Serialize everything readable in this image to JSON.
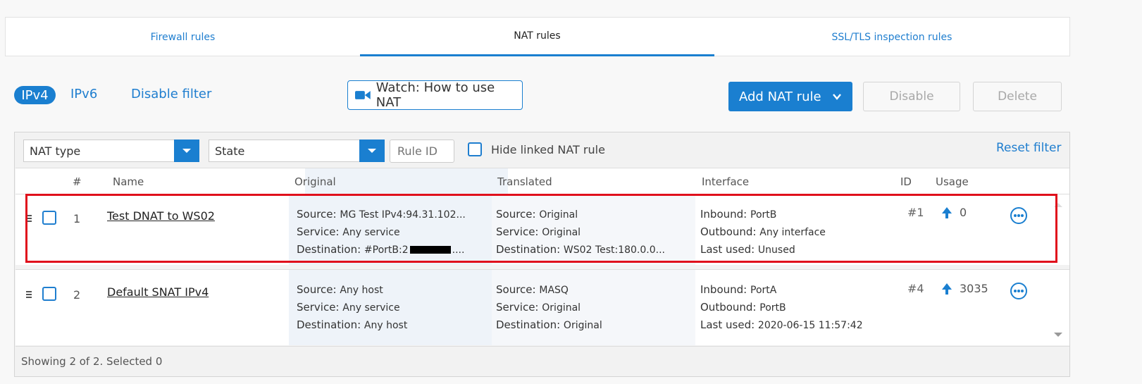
{
  "tabs": [
    {
      "label": "Firewall rules",
      "active": false
    },
    {
      "label": "NAT rules",
      "active": true
    },
    {
      "label": "SSL/TLS inspection rules",
      "active": false
    }
  ],
  "toolbar": {
    "ipv4": "IPv4",
    "ipv6": "IPv6",
    "disable_filter": "Disable filter",
    "watch_label": "Watch: How to use NAT",
    "add_rule": "Add NAT rule",
    "disable": "Disable",
    "delete": "Delete"
  },
  "filters": {
    "nat_type": "NAT type",
    "state": "State",
    "rule_id_placeholder": "Rule ID",
    "hide_linked": "Hide linked NAT rule",
    "reset": "Reset filter"
  },
  "columns": {
    "num": "#",
    "name": "Name",
    "original": "Original",
    "translated": "Translated",
    "interface": "Interface",
    "id": "ID",
    "usage": "Usage"
  },
  "rows": [
    {
      "num": "1",
      "name": "Test DNAT to WS02",
      "original": {
        "source_label": "Source:",
        "source": "MG Test IPv4:94.31.102...",
        "service_label": "Service:",
        "service": "Any service",
        "dest_label": "Destination:",
        "dest_prefix": "#PortB:2",
        "dest_suffix": "...."
      },
      "translated": {
        "source_label": "Source:",
        "source": "Original",
        "service_label": "Service:",
        "service": "Original",
        "dest_label": "Destination:",
        "dest": "WS02 Test:180.0.0..."
      },
      "interface": {
        "inbound_label": "Inbound:",
        "inbound": "PortB",
        "outbound_label": "Outbound:",
        "outbound": "Any interface",
        "last_label": "Last used:",
        "last": "Unused"
      },
      "id": "#1",
      "usage": "0"
    },
    {
      "num": "2",
      "name": "Default SNAT IPv4",
      "original": {
        "source_label": "Source:",
        "source": "Any host",
        "service_label": "Service:",
        "service": "Any service",
        "dest_label": "Destination:",
        "dest_prefix": "Any host",
        "dest_suffix": ""
      },
      "translated": {
        "source_label": "Source:",
        "source": "MASQ",
        "service_label": "Service:",
        "service": "Original",
        "dest_label": "Destination:",
        "dest": "Original"
      },
      "interface": {
        "inbound_label": "Inbound:",
        "inbound": "PortA",
        "outbound_label": "Outbound:",
        "outbound": "PortB",
        "last_label": "Last used:",
        "last": "2020-06-15 11:57:42"
      },
      "id": "#4",
      "usage": "3035"
    }
  ],
  "footer": "Showing 2 of 2. Selected 0",
  "colors": {
    "accent": "#1a7fd0",
    "highlight": "#e0101c"
  }
}
